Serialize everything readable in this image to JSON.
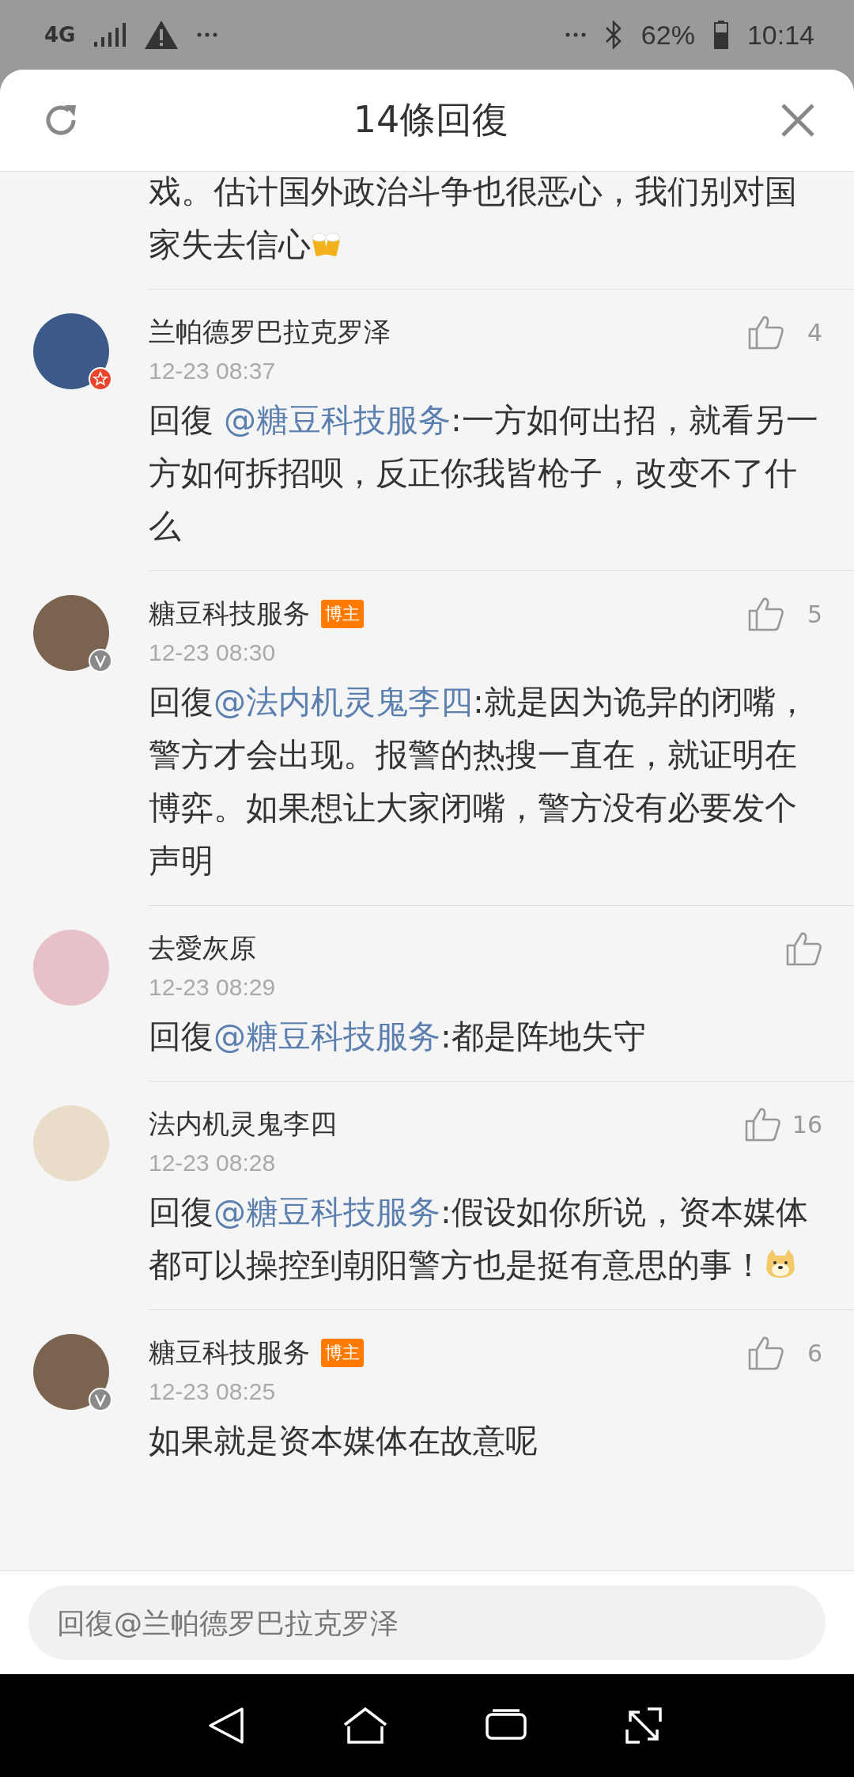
{
  "status_bar": {
    "network": "4G",
    "battery": "62%",
    "time": "10:14"
  },
  "header": {
    "title": "14條回復"
  },
  "comments": [
    {
      "kind": "continuation",
      "content": [
        {
          "kind": "text",
          "text": "戏。估计国外政治斗争也很恶心，我们别对国家失去信心"
        },
        {
          "kind": "cheers"
        }
      ]
    },
    {
      "kind": "star",
      "name": "兰帕德罗巴拉克罗泽",
      "likes": "4",
      "time": "12-23 08:37",
      "content": [
        {
          "kind": "text",
          "text": "回復 "
        },
        {
          "kind": "mention",
          "text": "@糖豆科技服务"
        },
        {
          "kind": "text",
          "text": ":一方如何出招，就看另一方如何拆招呗，反正你我皆枪子，改变不了什么"
        }
      ]
    },
    {
      "kind": "verified",
      "name": "糖豆科技服务",
      "badge": "博主",
      "likes": "5",
      "time": "12-23 08:30",
      "content": [
        {
          "kind": "text",
          "text": "回復"
        },
        {
          "kind": "mention",
          "text": "@法内机灵鬼李四"
        },
        {
          "kind": "text",
          "text": ":就是因为诡异的闭嘴，警方才会出现。报警的热搜一直在，就证明在博弈。如果想让大家闭嘴，警方没有必要发个声明"
        }
      ]
    },
    {
      "kind": "plain",
      "name": "去愛灰原",
      "time": "12-23 08:29",
      "content": [
        {
          "kind": "text",
          "text": "回復"
        },
        {
          "kind": "mention",
          "text": "@糖豆科技服务"
        },
        {
          "kind": "text",
          "text": ":都是阵地失守"
        }
      ]
    },
    {
      "kind": "plain",
      "name": "法内机灵鬼李四",
      "likes": "16",
      "time": "12-23 08:28",
      "content": [
        {
          "kind": "text",
          "text": "回復"
        },
        {
          "kind": "mention",
          "text": "@糖豆科技服务"
        },
        {
          "kind": "text",
          "text": ":假设如你所说，资本媒体都可以操控到朝阳警方也是挺有意思的事！"
        },
        {
          "kind": "doge"
        }
      ]
    },
    {
      "kind": "verified",
      "name": "糖豆科技服务",
      "badge": "博主",
      "likes": "6",
      "time": "12-23 08:25",
      "content": [
        {
          "kind": "text",
          "text": "如果就是资本媒体在故意呢"
        }
      ]
    }
  ],
  "reply_field": {
    "placeholder": "回復@兰帕德罗巴拉克罗泽"
  }
}
